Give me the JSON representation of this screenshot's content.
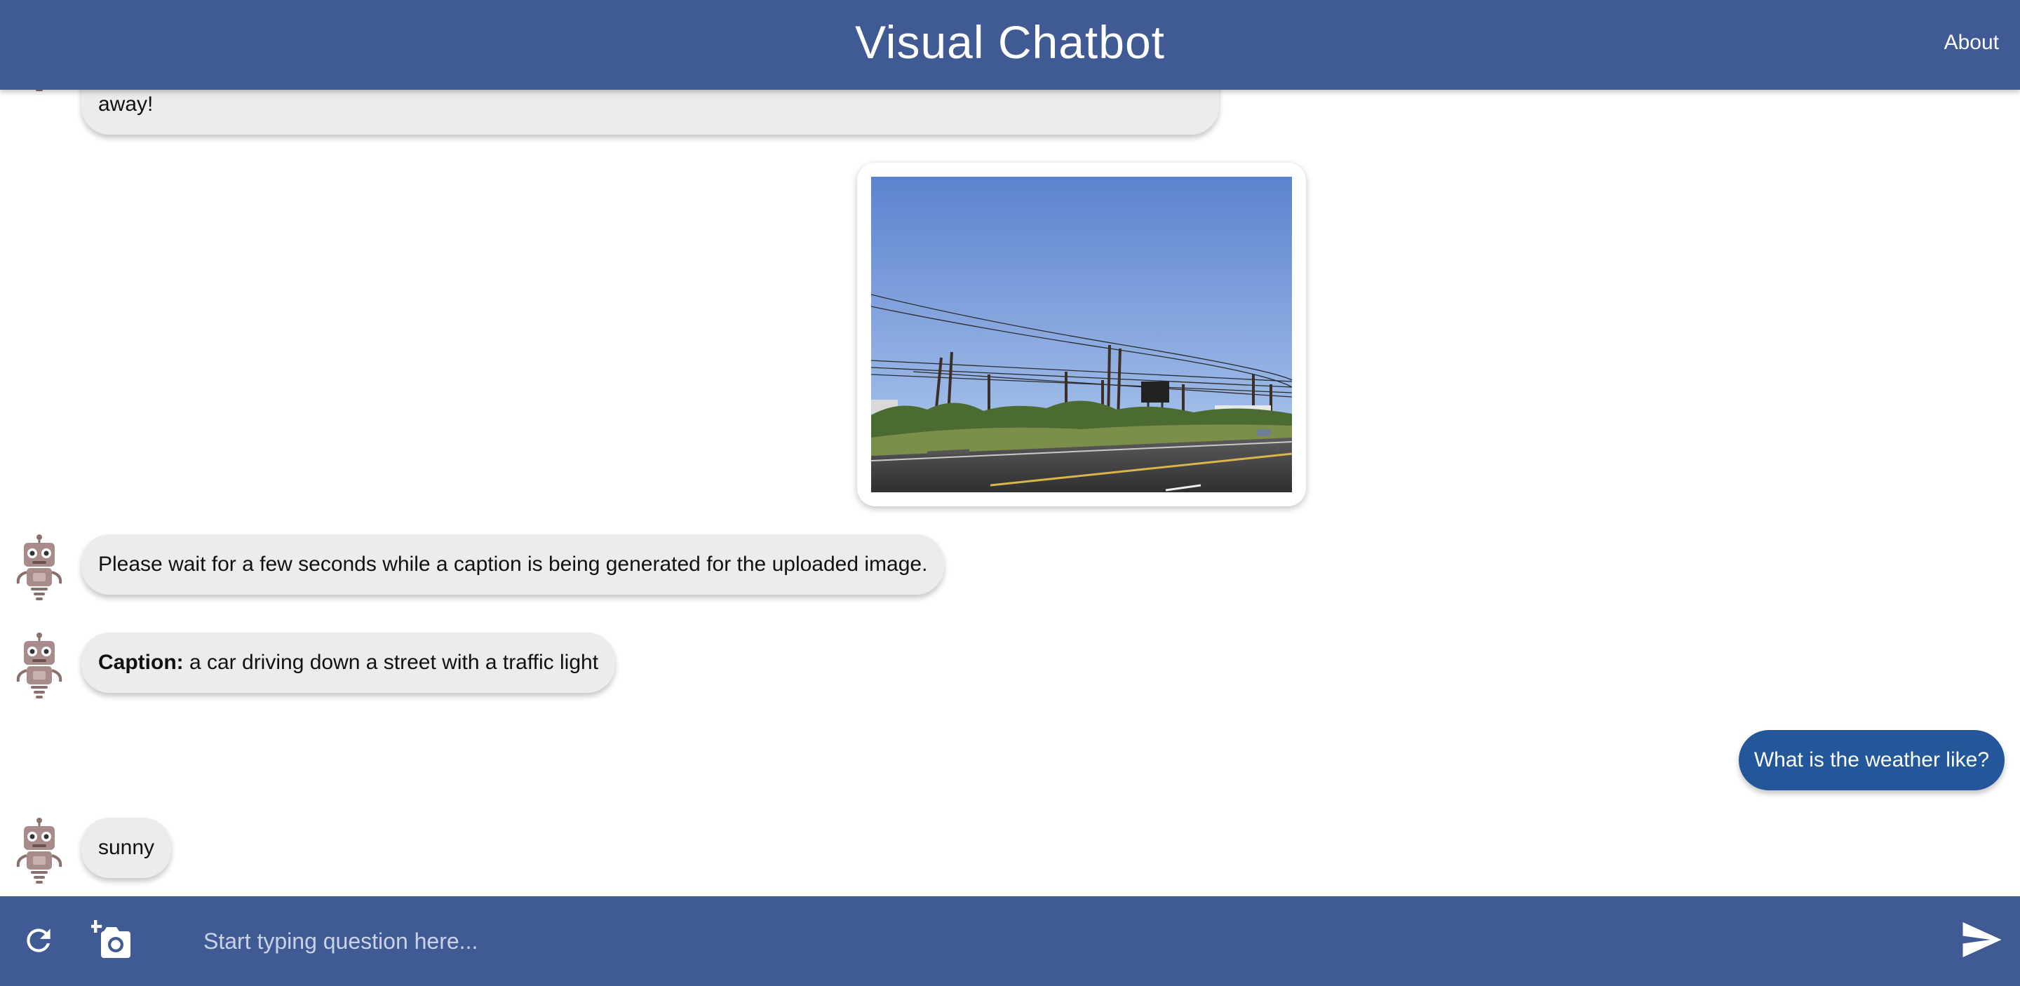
{
  "header": {
    "title": "Visual Chatbot",
    "about_label": "About"
  },
  "messages": {
    "bot_intro_tail": "away!",
    "bot_wait": "Please wait for a few seconds while a caption is being generated for the uploaded image.",
    "caption_label": "Caption:",
    "caption_text": " a car driving down a street with a traffic light",
    "user_question": "What is the weather like?",
    "bot_answer": "sunny"
  },
  "input": {
    "placeholder": "Start typing question here..."
  },
  "icons": {
    "refresh": "refresh-icon",
    "add_photo": "add-photo-icon",
    "send": "send-icon",
    "avatar": "robot-avatar-icon"
  },
  "colors": {
    "header_bg": "#405a94",
    "user_bubble": "#24579a",
    "bot_bubble": "#ececec"
  }
}
